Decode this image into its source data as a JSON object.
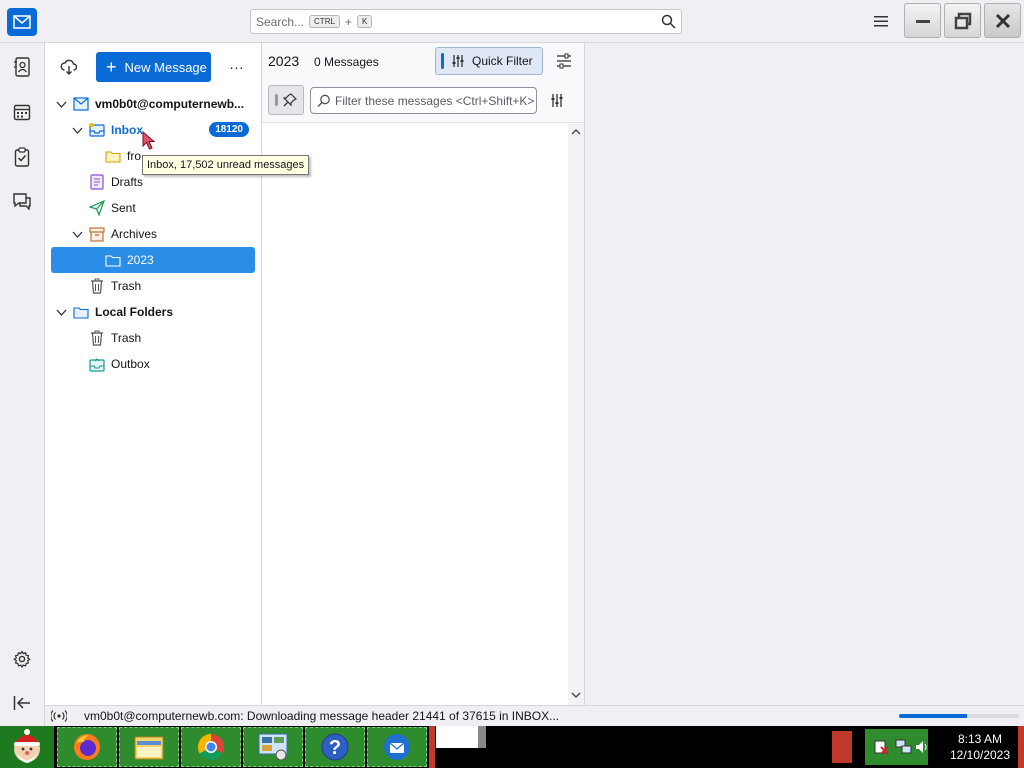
{
  "search": {
    "placeholder": "Search...",
    "kbd_ctrl": "CTRL",
    "kbd_plus": "+",
    "kbd_key": "K"
  },
  "folder_pane": {
    "new_message_label": "New Message",
    "more_label": "...",
    "account": "vm0b0t@computernewb...",
    "folders": {
      "inbox": {
        "label": "Inbox",
        "badge": "18120"
      },
      "sub": {
        "label": "fro"
      },
      "drafts": {
        "label": "Drafts"
      },
      "sent": {
        "label": "Sent"
      },
      "archives": {
        "label": "Archives"
      },
      "year": {
        "label": "2023"
      },
      "trash": {
        "label": "Trash"
      },
      "local_folders": {
        "label": "Local Folders"
      },
      "local_trash": {
        "label": "Trash"
      },
      "outbox": {
        "label": "Outbox"
      }
    },
    "tooltip": "Inbox, 17,502 unread messages"
  },
  "message_pane": {
    "folder_name": "2023",
    "message_count": "0 Messages",
    "quick_filter_label": "Quick Filter",
    "filter_placeholder": "Filter these messages <Ctrl+Shift+K>"
  },
  "status": {
    "text": "vm0b0t@computernewb.com: Downloading message header 21441 of 37615 in INBOX...",
    "progress": 0.57
  },
  "taskbar": {
    "time": "8:13 AM",
    "date": "12/10/2023"
  },
  "colors": {
    "accent": "#0b6bd6",
    "selection": "#2a8de6",
    "taskbar_green": "#2e8b2e"
  }
}
